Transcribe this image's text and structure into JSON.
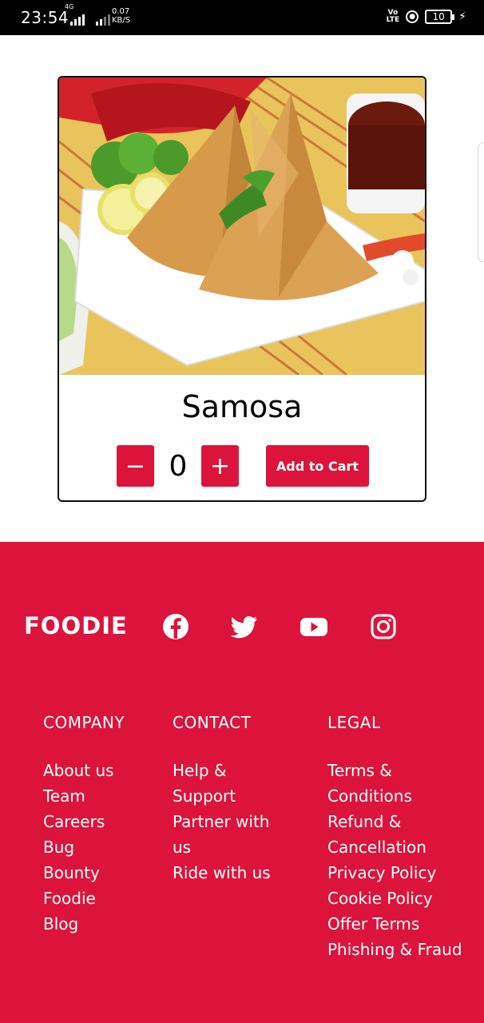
{
  "status_bar": {
    "time": "23:54",
    "network_type": "4G",
    "net_speed_value": "0.07",
    "net_speed_unit": "KB/S",
    "volte_top": "Vo",
    "volte_bottom": "LTE",
    "battery_level": "10"
  },
  "product": {
    "name": "Samosa",
    "quantity": "0",
    "minus_label": "−",
    "plus_label": "+",
    "add_to_cart_label": "Add to Cart",
    "accent_color": "#dc143c"
  },
  "footer": {
    "brand": "FOODIE",
    "social_icons": [
      "facebook-icon",
      "twitter-icon",
      "youtube-icon",
      "instagram-icon"
    ],
    "columns": [
      {
        "title": "COMPANY",
        "links": [
          "About us",
          "Team",
          "Careers",
          "Bug",
          "Bounty",
          "Foodie",
          "Blog"
        ]
      },
      {
        "title": "CONTACT",
        "links": [
          "Help &",
          "Support",
          "Partner with",
          "us",
          "Ride with us"
        ]
      },
      {
        "title": "LEGAL",
        "links": [
          "Terms &",
          "Conditions",
          "Refund &",
          "Cancellation",
          "Privacy Policy",
          "Cookie Policy",
          "Offer Terms",
          "Phishing & Fraud"
        ]
      }
    ],
    "background_color": "#dc143c"
  }
}
